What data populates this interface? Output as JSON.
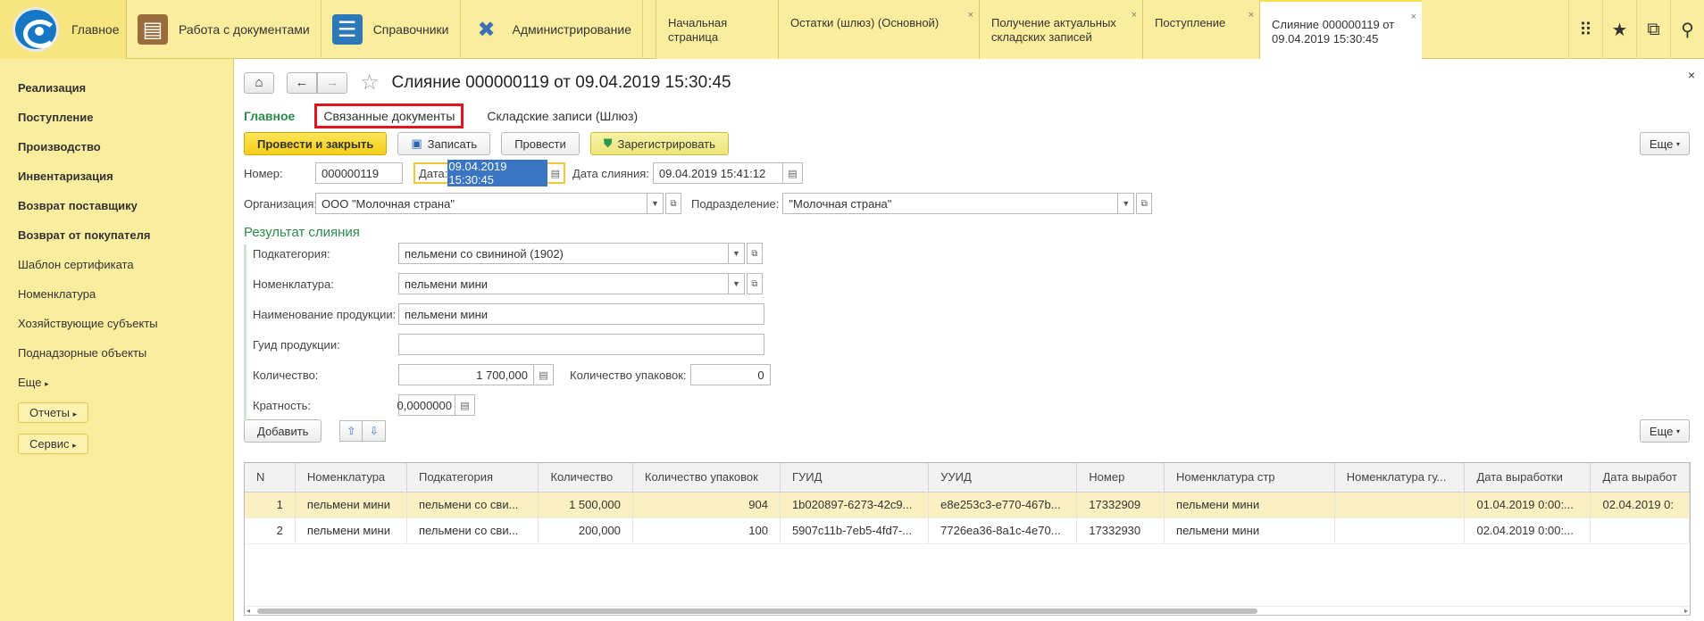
{
  "app": {
    "home_label": "Главное",
    "sections": [
      {
        "label": "Работа с документами",
        "icon": "briefcase-icon"
      },
      {
        "label": "Справочники",
        "icon": "book-icon"
      },
      {
        "label": "Администрирование",
        "icon": "tools-icon"
      }
    ],
    "tabs": [
      {
        "label": "Начальная страница",
        "closable": false,
        "active": false
      },
      {
        "label": "Остатки (шлюз) (Основной)",
        "closable": true,
        "active": false
      },
      {
        "label": "Получение актуальных складских записей",
        "closable": true,
        "active": false
      },
      {
        "label": "Поступление",
        "closable": true,
        "active": false
      },
      {
        "label": "Слияние 000000119 от 09.04.2019 15:30:45",
        "closable": true,
        "active": true
      }
    ],
    "close_glyph": "×"
  },
  "sidebar": {
    "items": [
      {
        "label": "Реализация",
        "bold": true
      },
      {
        "label": "Поступление",
        "bold": true
      },
      {
        "label": "Производство",
        "bold": true
      },
      {
        "label": "Инвентаризация",
        "bold": true
      },
      {
        "label": "Возврат поставщику",
        "bold": true
      },
      {
        "label": "Возврат от покупателя",
        "bold": true
      },
      {
        "label": "Шаблон сертификата",
        "bold": false
      },
      {
        "label": "Номенклатура",
        "bold": false
      },
      {
        "label": "Хозяйствующие субъекты",
        "bold": false
      },
      {
        "label": "Поднадзорные объекты",
        "bold": false
      },
      {
        "label": "Еще",
        "bold": false
      }
    ],
    "reports_label": "Отчеты",
    "service_label": "Сервис"
  },
  "document": {
    "title": "Слияние 000000119 от 09.04.2019 15:30:45",
    "links": {
      "main": "Главное",
      "related": "Связанные документы",
      "gateway": "Складские записи (Шлюз)"
    },
    "toolbar": {
      "post_close": "Провести и закрыть",
      "save": "Записать",
      "post": "Провести",
      "register": "Зарегистрировать",
      "more": "Еще"
    },
    "fields": {
      "number_label": "Номер:",
      "number_value": "000000119",
      "date_label": "Дата:",
      "date_value": "09.04.2019 15:30:45",
      "merge_date_label": "Дата слияния:",
      "merge_date_value": "09.04.2019 15:41:12",
      "org_label": "Организация:",
      "org_value": "ООО \"Молочная страна\"",
      "division_label": "Подразделение:",
      "division_value": "\"Молочная страна\""
    },
    "result": {
      "title": "Результат слияния",
      "subcategory_label": "Подкатегория:",
      "subcategory_value": "пельмени со свининой (1902)",
      "nomenclature_label": "Номенклатура:",
      "nomenclature_value": "пельмени мини",
      "product_name_label": "Наименование продукции:",
      "product_name_value": "пельмени мини",
      "guid_label": "Гуид продукции:",
      "guid_value": "",
      "quantity_label": "Количество:",
      "quantity_value": "1 700,000",
      "packages_label": "Количество упаковок:",
      "packages_value": "0",
      "multiplicity_label": "Кратность:",
      "multiplicity_value": "0,0000000"
    },
    "grid": {
      "add_label": "Добавить",
      "more_label": "Еще",
      "columns": [
        "N",
        "Номенклатура",
        "Подкатегория",
        "Количество",
        "Количество упаковок",
        "ГУИД",
        "УУИД",
        "Номер",
        "Номенклатура стр",
        "Номенклатура гу...",
        "Дата выработки",
        "Дата выработ"
      ],
      "rows": [
        [
          "1",
          "пельмени мини",
          "пельмени со сви...",
          "1 500,000",
          "904",
          "1b020897-6273-42c9...",
          "e8e253c3-e770-467b...",
          "17332909",
          "пельмени мини",
          "",
          "01.04.2019 0:00:...",
          "02.04.2019 0:"
        ],
        [
          "2",
          "пельмени мини",
          "пельмени со сви...",
          "200,000",
          "100",
          "5907c11b-7eb5-4fd7-...",
          "7726ea36-8a1c-4e70...",
          "17332930",
          "пельмени мини",
          "",
          "02.04.2019 0:00:...",
          ""
        ]
      ]
    }
  }
}
